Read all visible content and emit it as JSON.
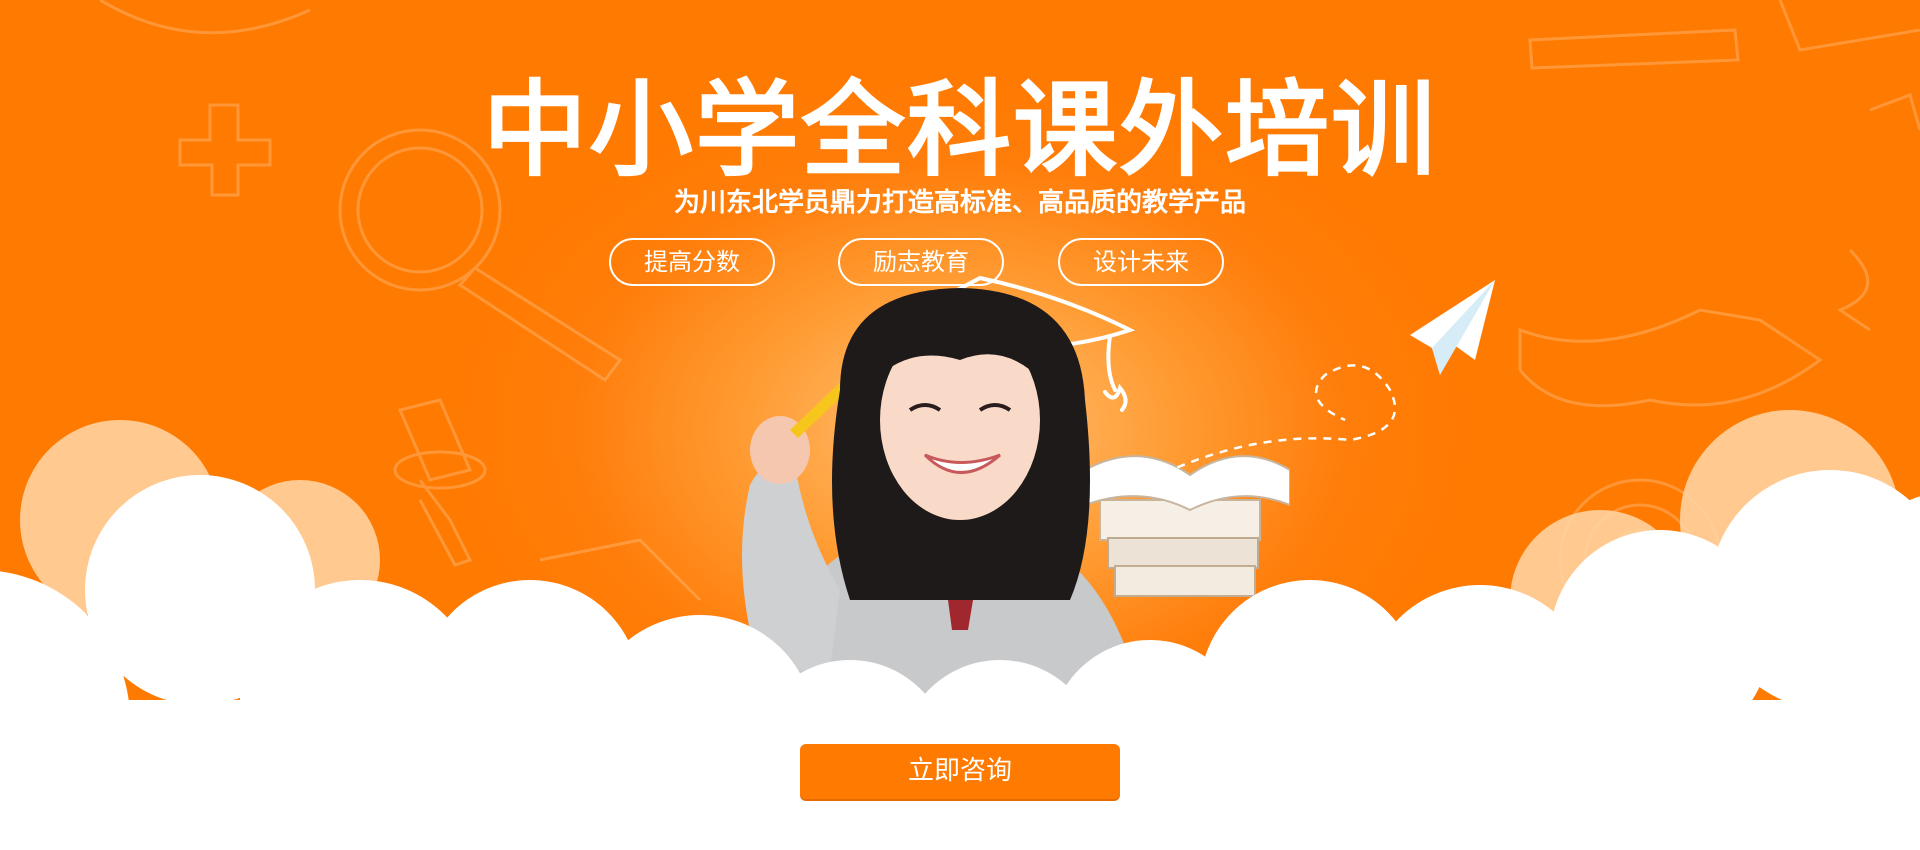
{
  "hero": {
    "title": "中小学全科课外培训",
    "subtitle": "为川东北学员鼎力打造高标准、高品质的教学产品",
    "tags": [
      "提高分数",
      "励志教育",
      "设计未来"
    ],
    "cta_label": "立即咨询"
  },
  "colors": {
    "brand_orange": "#ff7a00",
    "light_orange": "#ffc27a",
    "white": "#ffffff",
    "cloud": "#ffffff"
  },
  "icons": [
    "graduation-cap-icon",
    "paper-plane-icon",
    "magnifier-icon",
    "plus-icon",
    "books-icon",
    "pencil-icon"
  ]
}
